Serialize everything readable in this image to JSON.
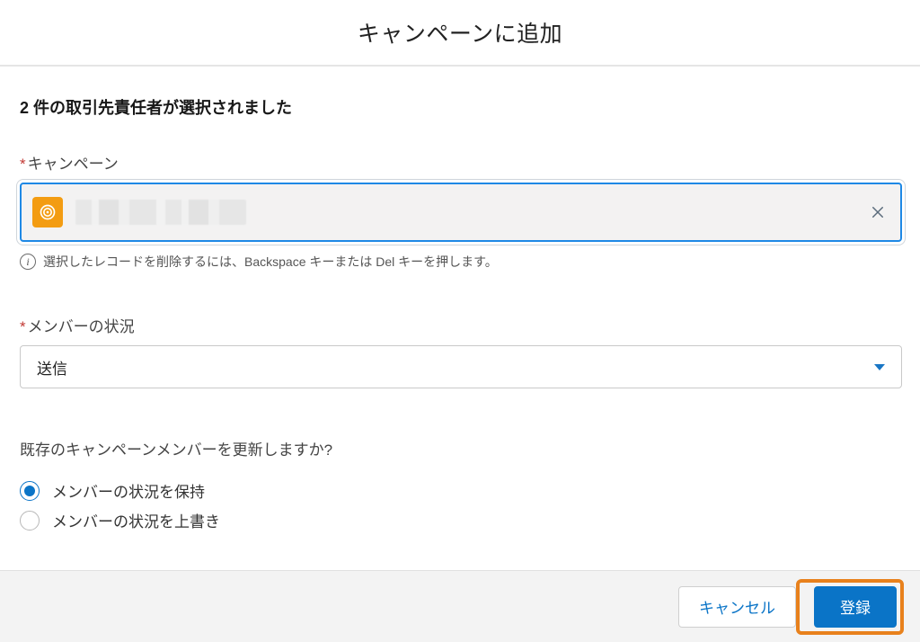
{
  "modal": {
    "title": "キャンペーンに追加",
    "selection_count_text": "2 件の取引先責任者が選択されました"
  },
  "campaign_field": {
    "label": "キャンペーン",
    "selected_name": "",
    "hint": "選択したレコードを削除するには、Backspace キーまたは Del キーを押します。"
  },
  "status_field": {
    "label": "メンバーの状況",
    "value": "送信"
  },
  "update_group": {
    "question": "既存のキャンペーンメンバーを更新しますか?",
    "options": [
      {
        "label": "メンバーの状況を保持",
        "checked": true
      },
      {
        "label": "メンバーの状況を上書き",
        "checked": false
      }
    ]
  },
  "footer": {
    "cancel_label": "キャンセル",
    "submit_label": "登録"
  }
}
